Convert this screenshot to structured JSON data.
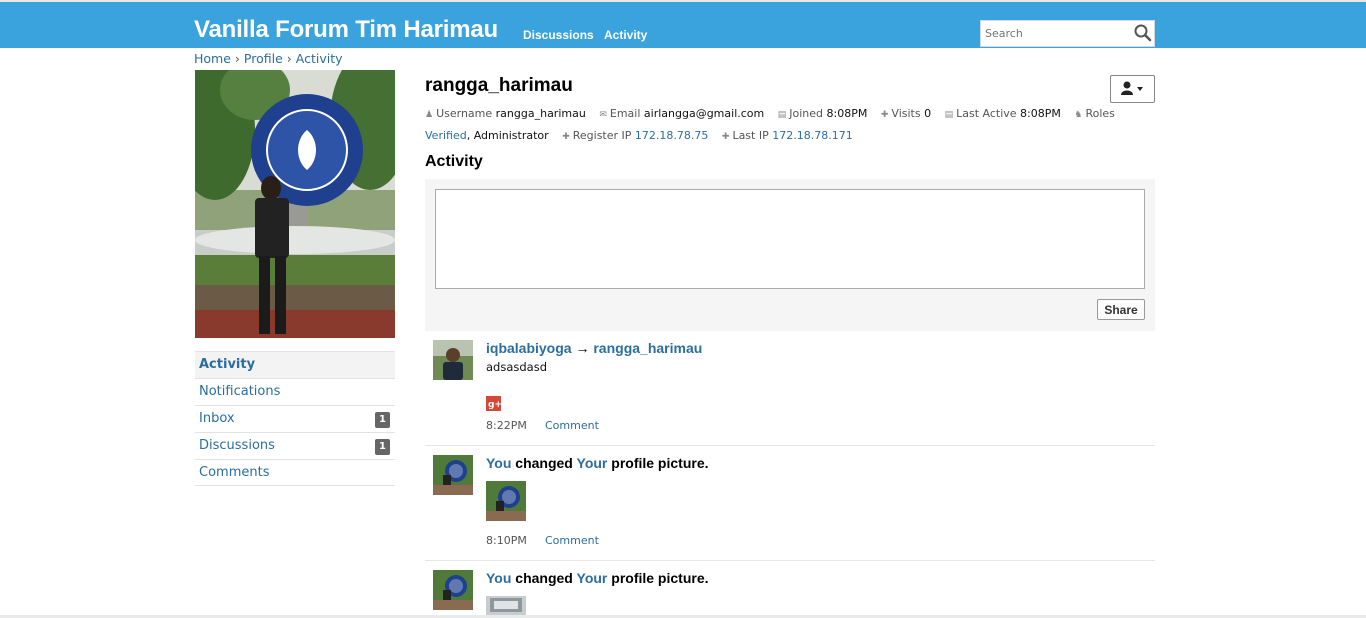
{
  "site": {
    "title": "Vanilla Forum Tim Harimau",
    "nav": [
      "Discussions",
      "Activity"
    ],
    "search_placeholder": "Search"
  },
  "breadcrumb": [
    "Home",
    "Profile",
    "Activity"
  ],
  "breadcrumb_sep": "›",
  "sidebar": {
    "items": [
      {
        "label": "Activity",
        "active": true
      },
      {
        "label": "Notifications"
      },
      {
        "label": "Inbox",
        "count": "1"
      },
      {
        "label": "Discussions",
        "count": "1"
      },
      {
        "label": "Comments"
      }
    ]
  },
  "profile": {
    "name": "rangga_harimau",
    "username_label": "Username",
    "username": "rangga_harimau",
    "email_label": "Email",
    "email": "airlangga@gmail.com",
    "joined_label": "Joined",
    "joined": "8:08PM",
    "visits_label": "Visits",
    "visits": "0",
    "last_active_label": "Last Active",
    "last_active": "8:08PM",
    "roles_label": "Roles",
    "roles_verified": "Verified",
    "roles_rest": ", Administrator",
    "register_ip_label": "Register IP",
    "register_ip": "172.18.78.75",
    "last_ip_label": "Last IP",
    "last_ip": "172.18.78.171"
  },
  "activity_title": "Activity",
  "share_label": "Share",
  "activities": [
    {
      "from": "iqbalabiyoga",
      "arrow": "→",
      "to": "rangga_harimau",
      "body": "adsasdasd",
      "time": "8:22PM",
      "comment": "Comment"
    },
    {
      "subject": "You",
      "verb": "changed",
      "object": "Your",
      "rest": "profile picture.",
      "time": "8:10PM",
      "comment": "Comment"
    },
    {
      "subject": "You",
      "verb": "changed",
      "object": "Your",
      "rest": "profile picture."
    }
  ],
  "colors": {
    "header": "#3aa2dd",
    "link": "#2b6e9e"
  }
}
